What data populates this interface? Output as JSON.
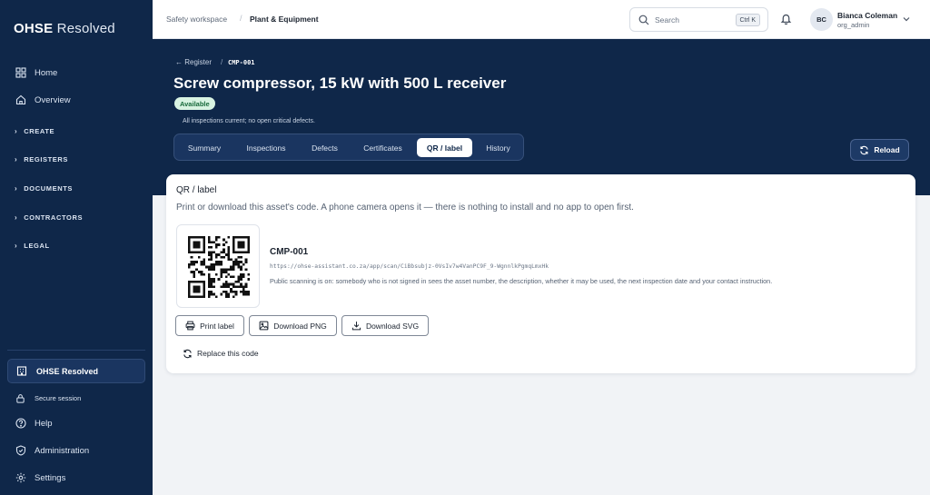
{
  "brand": {
    "strong": "OHSE",
    "rest": " Resolved"
  },
  "sidebar": {
    "items": [
      {
        "label": "Home",
        "icon": "grid-icon"
      },
      {
        "label": "Overview",
        "icon": "home-icon"
      }
    ],
    "groups": [
      "CREATE",
      "REGISTERS",
      "DOCUMENTS",
      "CONTRACTORS",
      "LEGAL"
    ],
    "org": {
      "label": "OHSE Resolved",
      "icon": "building-icon"
    },
    "footer": [
      {
        "label": "Secure session",
        "icon": "lock-icon"
      },
      {
        "label": "Help",
        "icon": "help-icon"
      },
      {
        "label": "Administration",
        "icon": "shield-icon"
      },
      {
        "label": "Settings",
        "icon": "gear-icon"
      }
    ]
  },
  "topbar": {
    "breadcrumb_workspace": "Safety workspace",
    "breadcrumb_separator": "/",
    "breadcrumb_current": "Plant & Equipment",
    "search_placeholder": "Search",
    "search_shortcut": "Ctrl K",
    "user": {
      "initials": "BC",
      "name": "Bianca Coleman",
      "role": "org_admin"
    }
  },
  "hero": {
    "back_label": "← Register",
    "back_separator": "/",
    "asset_code": "CMP-001",
    "title": "Screw compressor, 15 kW with 500 L receiver",
    "status_badge": "Available",
    "status_note": "All inspections current; no open critical defects.",
    "tabs": [
      "Summary",
      "Inspections",
      "Defects",
      "Certificates",
      "QR / label",
      "History"
    ],
    "active_tab": "QR / label",
    "reload_label": "Reload"
  },
  "qr_card": {
    "title": "QR / label",
    "subtitle": "Print or download this asset's code. A phone camera opens it — there is nothing to install and no app to open first.",
    "code": "CMP-001",
    "url": "https://ohse-assistant.co.za/app/scan/CiBbsubjz-0VsIv7w4VanPC9F_9-WgnnlkPgmqLmxHk",
    "public_note": "Public scanning is on: somebody who is not signed in sees the asset number, the description, whether it may be used, the next inspection date and your contact instruction.",
    "buttons": {
      "print": "Print label",
      "png": "Download PNG",
      "svg": "Download SVG"
    },
    "replace_label": "Replace this code"
  },
  "colors": {
    "navy": "#0f2749",
    "badge_bg": "#d8f3e2",
    "badge_text": "#17693a",
    "page_bg": "#f1f3f6"
  }
}
